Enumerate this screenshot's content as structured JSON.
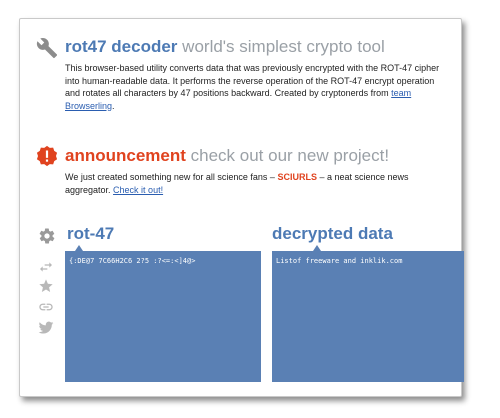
{
  "about": {
    "title_strong": "rot47 decoder",
    "title_rest": "world's simplest crypto tool",
    "text_1": "This browser-based utility converts data that was previously encrypted with the ROT-47 cipher into human-readable data. It performs the reverse operation of the ROT-47 encrypt operation and rotates all characters by 47 positions backward. Created by cryptonerds from ",
    "link": "team Browserling",
    "text_2": "."
  },
  "announcement": {
    "title_strong": "announcement",
    "title_rest": "check out our new project!",
    "text_1": "We just created something new for all science fans – ",
    "brand": "SCIURLS",
    "text_2": " – a neat science news aggregator. ",
    "link": "Check it out!"
  },
  "tool": {
    "input_title": "rot-47",
    "output_title": "decrypted data",
    "input_value": "{:DE@7 7C66H2C6 2?5 :?<=:<]4@>",
    "output_value": "Listof freeware and inklik.com"
  },
  "icons": {
    "about": "wrench-icon",
    "announcement": "alert-icon",
    "settings": "gear-icon",
    "swap": "swap-icon",
    "star": "star-icon",
    "link": "link-icon",
    "twitter": "twitter-icon"
  },
  "colors": {
    "accent": "#4d7ab4",
    "alert": "#e0431f",
    "pane": "#5a80b4",
    "muted": "#9aa0a6"
  }
}
